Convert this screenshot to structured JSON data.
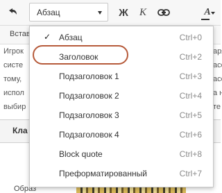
{
  "toolbar": {
    "format_value": "Абзац",
    "bold_label": "Ж",
    "italic_label": "К",
    "text_color_label": "A",
    "icons": [
      "undo-icon",
      "chevron-down-icon",
      "link-icon",
      "text-color-icon"
    ]
  },
  "row2": {
    "insert_label": "Встав"
  },
  "background": {
    "left_lines": [
      "Игрок",
      "систе",
      "тому,",
      "испол",
      "выбир"
    ],
    "right_fragments": [
      "аря",
      "асс",
      "асс",
      "а н",
      "те"
    ],
    "table_header": "Кла",
    "row_label": "Образ"
  },
  "dropdown": {
    "items": [
      {
        "label": "Абзац",
        "shortcut": "Ctrl+0",
        "checked": true
      },
      {
        "label": "Заголовок",
        "shortcut": "Ctrl+2",
        "checked": false
      },
      {
        "label": "Подзаголовок 1",
        "shortcut": "Ctrl+3",
        "checked": false
      },
      {
        "label": "Подзаголовок 2",
        "shortcut": "Ctrl+4",
        "checked": false
      },
      {
        "label": "Подзаголовок 3",
        "shortcut": "Ctrl+5",
        "checked": false
      },
      {
        "label": "Подзаголовок 4",
        "shortcut": "Ctrl+6",
        "checked": false
      },
      {
        "label": "Block quote",
        "shortcut": "Ctrl+8",
        "checked": false
      },
      {
        "label": "Преформатированный",
        "shortcut": "Ctrl+7",
        "checked": false
      }
    ],
    "check_mark": "✓",
    "highlighted_item": "Заголовок",
    "highlight_color": "#b65a3a"
  }
}
